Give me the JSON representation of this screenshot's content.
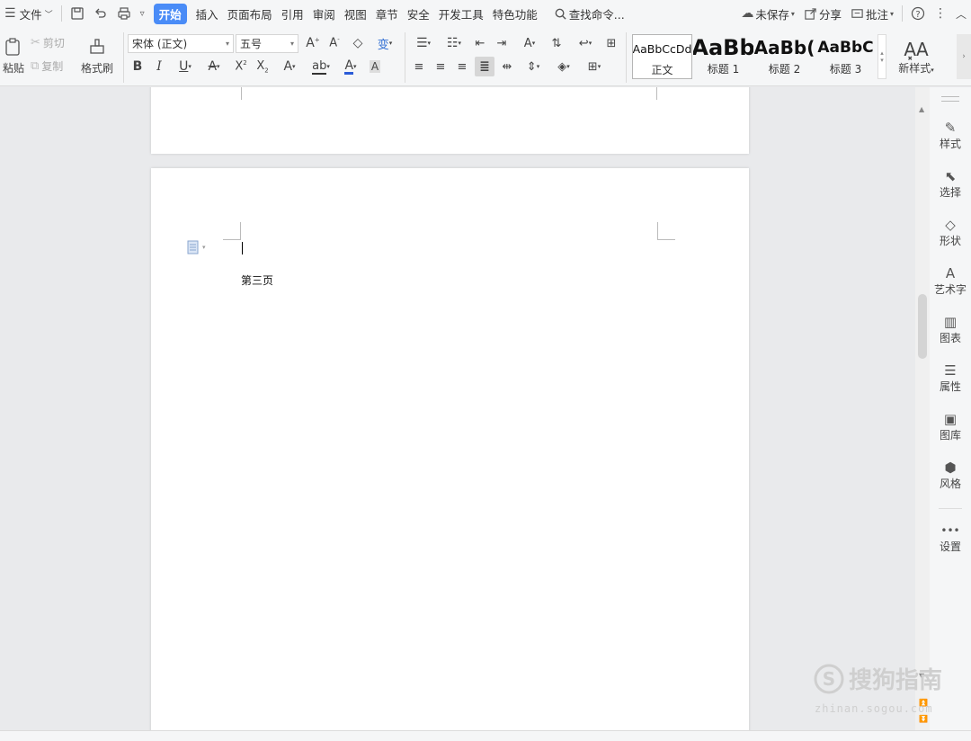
{
  "menubar": {
    "file_label": "文件",
    "tabs": [
      {
        "label": "开始",
        "active": true
      },
      {
        "label": "插入"
      },
      {
        "label": "页面布局"
      },
      {
        "label": "引用"
      },
      {
        "label": "审阅"
      },
      {
        "label": "视图"
      },
      {
        "label": "章节"
      },
      {
        "label": "安全"
      },
      {
        "label": "开发工具"
      },
      {
        "label": "特色功能"
      }
    ],
    "search_label": "查找命令...",
    "unsaved_label": "未保存",
    "share_label": "分享",
    "comment_label": "批注",
    "accent_color": "#4a8cf7"
  },
  "ribbon": {
    "paste_label": "粘贴",
    "cut_label": "剪切",
    "copy_label": "复制",
    "format_painter_label": "格式刷",
    "font_name": "宋体 (正文)",
    "font_size": "五号",
    "styles": [
      {
        "preview": "AaBbCcDd",
        "label": "正文"
      },
      {
        "preview": "AaBb",
        "label": "标题 1"
      },
      {
        "preview": "AaBb(",
        "label": "标题 2"
      },
      {
        "preview": "AaBbC",
        "label": "标题 3"
      }
    ],
    "new_style_label": "新样式"
  },
  "document": {
    "page_text": "第三页"
  },
  "right_panel": {
    "items": [
      "样式",
      "选择",
      "形状",
      "艺术字",
      "图表",
      "属性",
      "图库",
      "风格",
      "设置"
    ]
  },
  "watermark": {
    "text": "搜狗指南",
    "url": "zhinan.sogou.com"
  }
}
